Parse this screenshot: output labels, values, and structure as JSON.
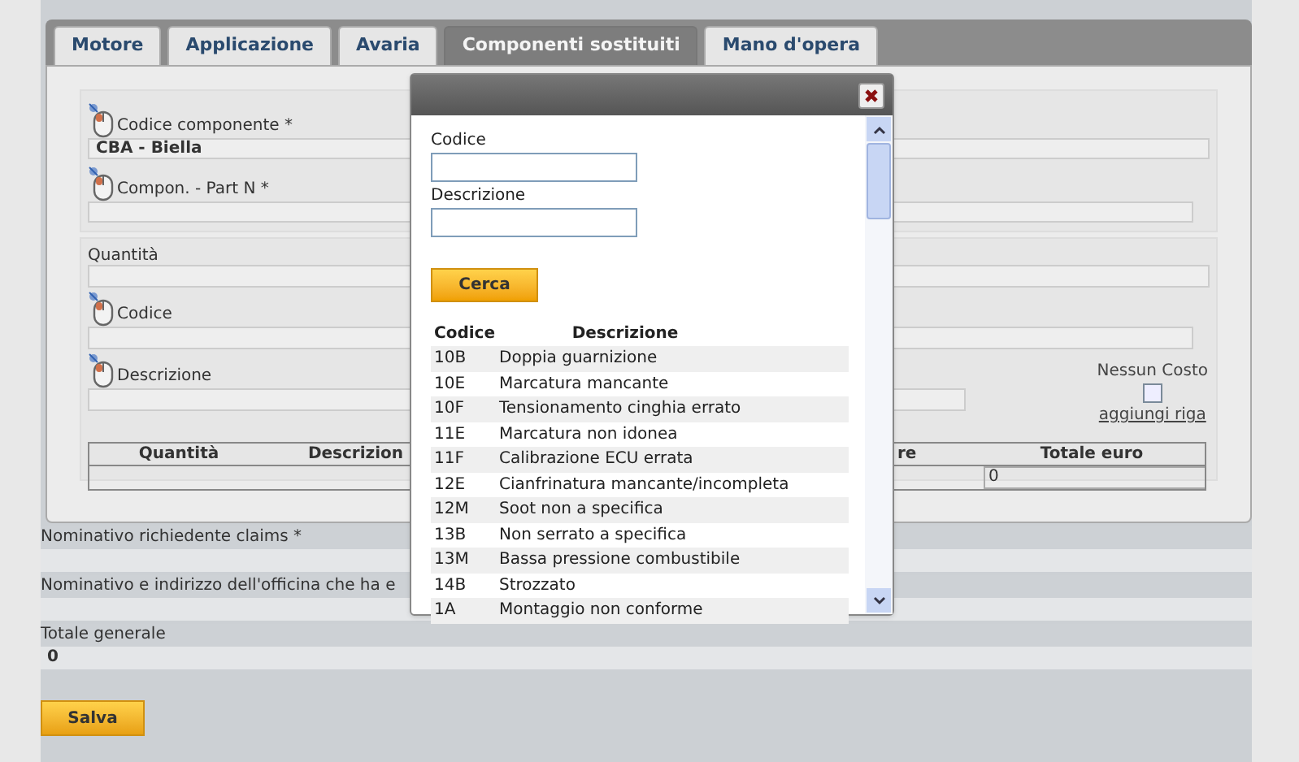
{
  "tabs": [
    {
      "label": "Motore",
      "selected": false
    },
    {
      "label": "Applicazione",
      "selected": false
    },
    {
      "label": "Avaria",
      "selected": false
    },
    {
      "label": "Componenti sostituiti",
      "selected": true
    },
    {
      "label": "Mano d'opera",
      "selected": false
    }
  ],
  "component": {
    "code_label": "Codice componente *",
    "code_value": "CBA - Biella",
    "part_label": "Compon. - Part N *"
  },
  "parts": {
    "quantity_label": "Quantità",
    "code_label": "Codice",
    "description_label": "Descrizione",
    "no_cost": {
      "label": "Nessun Costo",
      "checked": false
    },
    "add_row_link": "aggiungi riga",
    "table": {
      "columns": [
        "Quantità",
        "Descrizion",
        "re",
        "Totale euro"
      ],
      "total_value": "0"
    }
  },
  "footer": [
    {
      "label": "Nominativo richiedente claims *"
    },
    {
      "label": "Nominativo e indirizzo dell'officina che ha e"
    },
    {
      "label": "Totale generale",
      "value": "0"
    }
  ],
  "save_button": "Salva",
  "dialog": {
    "fields": [
      {
        "label": "Codice"
      },
      {
        "label": "Descrizione"
      }
    ],
    "search_button": "Cerca",
    "columns": [
      "Codice",
      "Descrizione"
    ],
    "rows": [
      {
        "code": "10B",
        "description": "Doppia guarnizione"
      },
      {
        "code": "10E",
        "description": "Marcatura mancante"
      },
      {
        "code": "10F",
        "description": "Tensionamento cinghia errato"
      },
      {
        "code": "11E",
        "description": "Marcatura non idonea"
      },
      {
        "code": "11F",
        "description": "Calibrazione ECU errata"
      },
      {
        "code": "12E",
        "description": "Cianfrinatura mancante/incompleta"
      },
      {
        "code": "12M",
        "description": "Soot non a specifica"
      },
      {
        "code": "13B",
        "description": "Non serrato a specifica"
      },
      {
        "code": "13M",
        "description": "Bassa pressione combustibile"
      },
      {
        "code": "14B",
        "description": "Strozzato"
      },
      {
        "code": "1A",
        "description": "Montaggio non conforme"
      }
    ]
  }
}
